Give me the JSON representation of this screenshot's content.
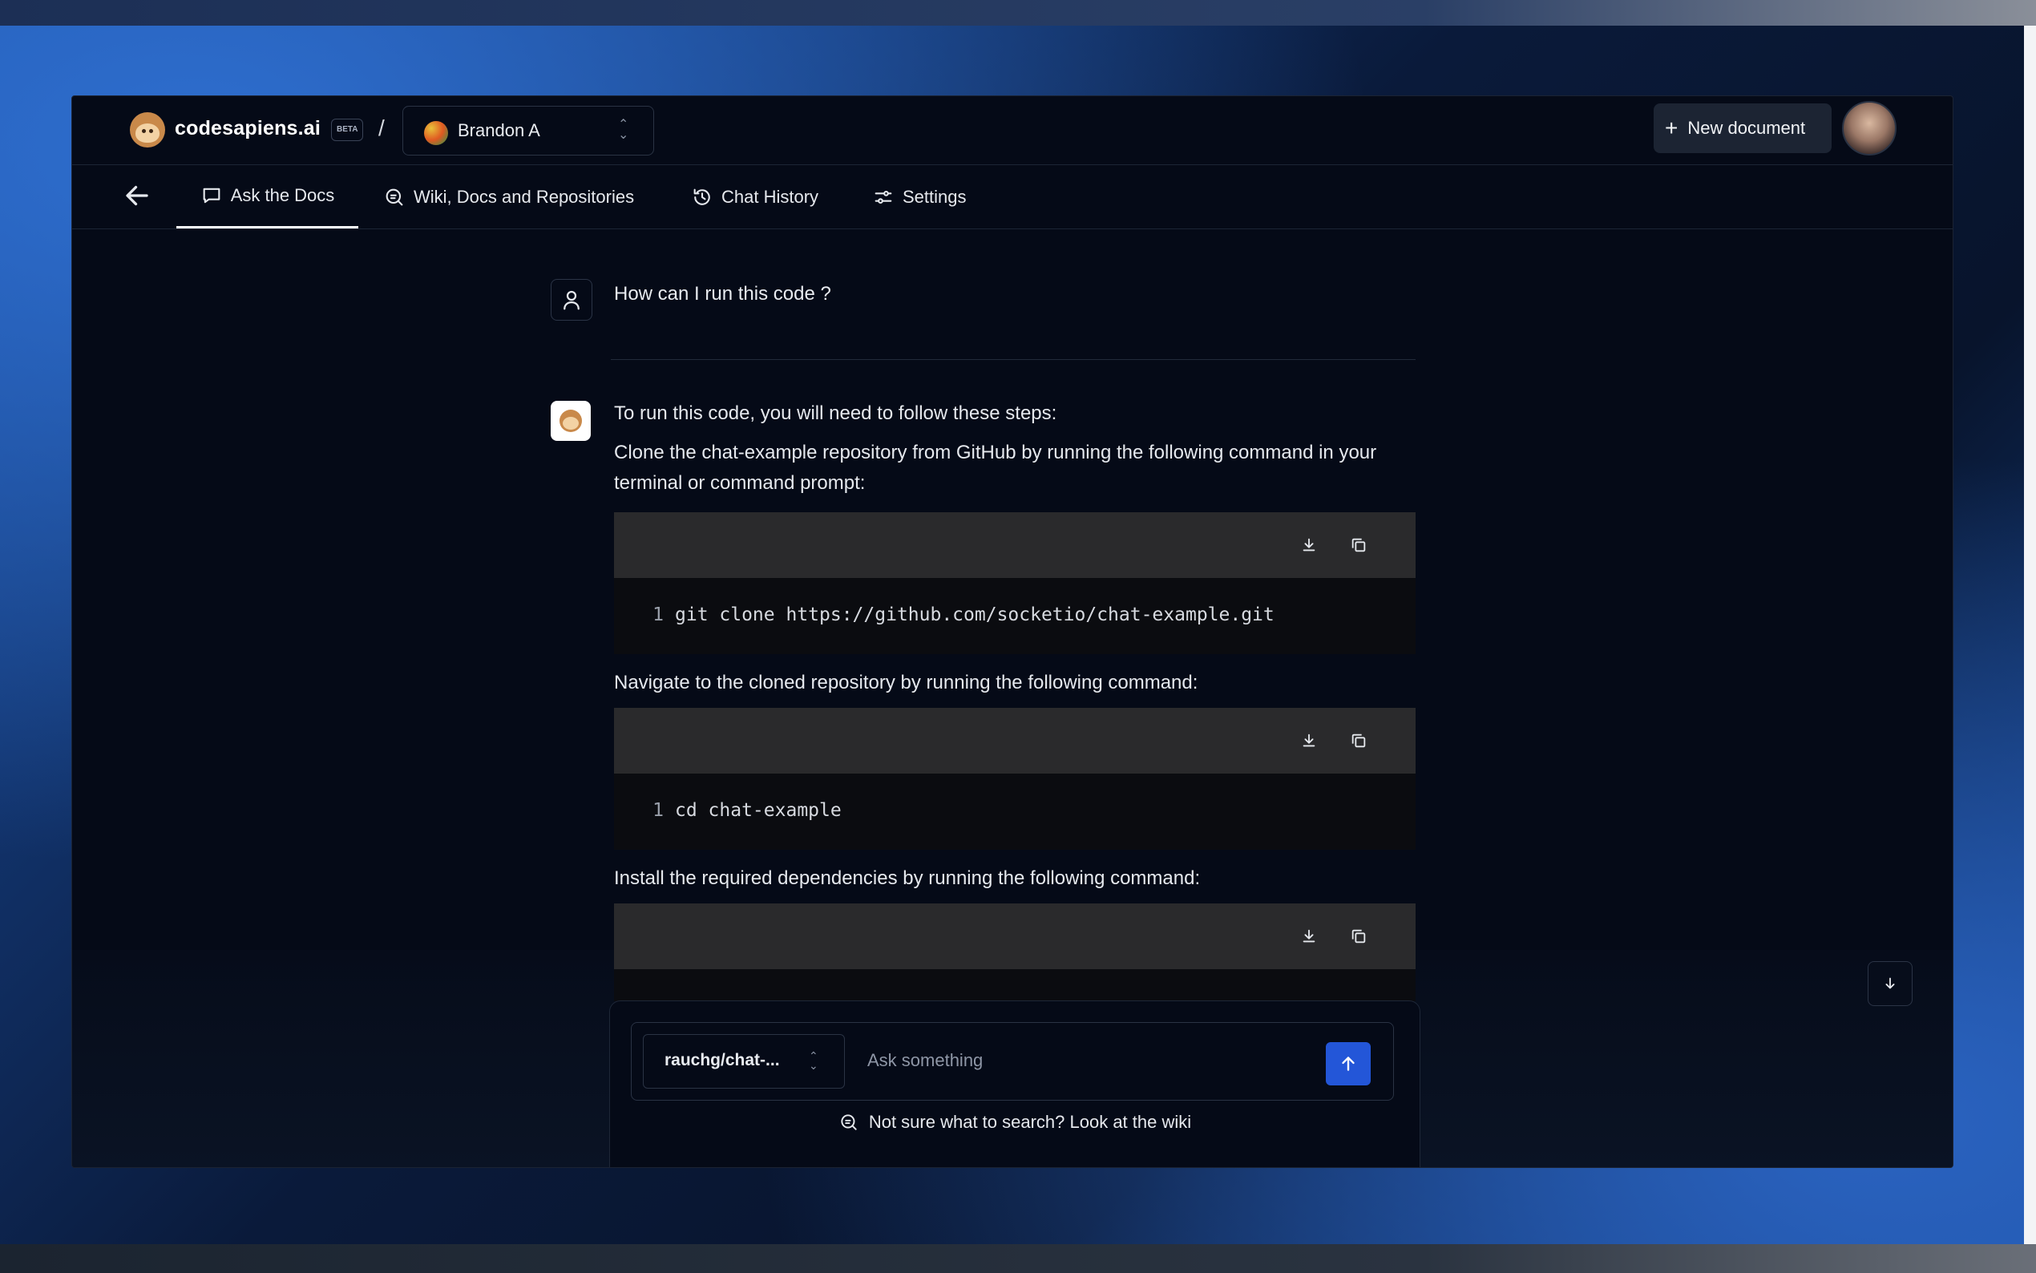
{
  "header": {
    "brand": "codesapiens.ai",
    "badge": "BETA",
    "separator": "/",
    "org_name": "Brandon A",
    "new_document_label": "New document"
  },
  "nav": {
    "tabs": [
      {
        "label": "Ask the Docs",
        "icon": "chat-bubble-icon",
        "active": true
      },
      {
        "label": "Wiki, Docs and Repositories",
        "icon": "search-document-icon",
        "active": false
      },
      {
        "label": "Chat History",
        "icon": "history-icon",
        "active": false
      },
      {
        "label": "Settings",
        "icon": "sliders-icon",
        "active": false
      }
    ]
  },
  "chat": {
    "question": "How can I run this code ?",
    "intro": "To run this code, you will need to follow these steps:",
    "steps": [
      {
        "text": "Clone the chat-example repository from GitHub by running the following command in your terminal or command prompt:",
        "code_line_no": "1",
        "code": "git clone https://github.com/socketio/chat-example.git"
      },
      {
        "text": "Navigate to the cloned repository by running the following command:",
        "code_line_no": "1",
        "code": "cd chat-example"
      },
      {
        "text": "Install the required dependencies by running the following command:",
        "code_line_no": "",
        "code": ""
      }
    ]
  },
  "composer": {
    "repo_selected": "rauchg/chat-...",
    "placeholder": "Ask something",
    "wiki_hint": "Not sure what to search? Look at the wiki"
  },
  "colors": {
    "accent": "#2356d8",
    "app_background": "#050a17",
    "code_header": "#2a2a2c"
  }
}
